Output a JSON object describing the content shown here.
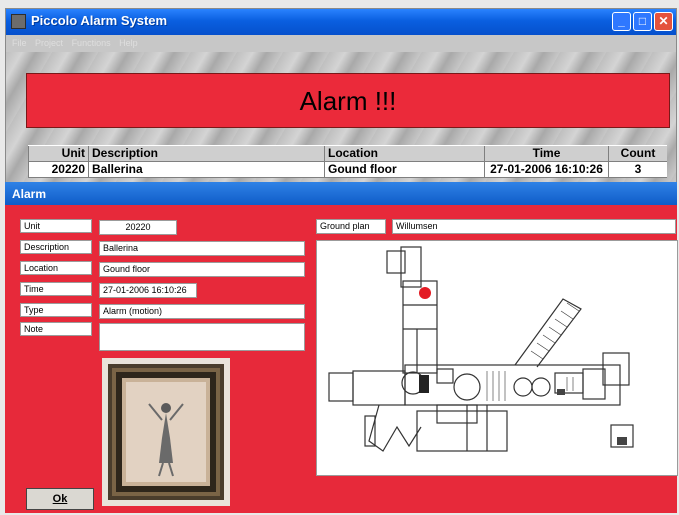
{
  "window": {
    "title": "Piccolo Alarm System"
  },
  "menu": [
    "File",
    "Project",
    "Functions",
    "Help"
  ],
  "banner": {
    "text": "Alarm !!!"
  },
  "table": {
    "headers": [
      "Unit",
      "Description",
      "Location",
      "Time",
      "Count"
    ],
    "rows": [
      [
        "20220",
        "Ballerina",
        "Gound floor",
        "27-01-2006 16:10:26",
        "3"
      ]
    ]
  },
  "dialog": {
    "title": "Alarm",
    "labels": {
      "unit": "Unit",
      "description": "Description",
      "location": "Location",
      "time": "Time",
      "type": "Type",
      "note": "Note",
      "ground_plan": "Ground plan"
    },
    "values": {
      "unit": "20220",
      "description": "Ballerina",
      "location": "Gound floor",
      "time": "27-01-2006 16:10:26",
      "type": "Alarm (motion)",
      "note": "",
      "ground_plan": "Willumsen"
    },
    "ok_label": "Ok"
  },
  "colors": {
    "alarm_red": "#eb2a3a",
    "dialog_red": "#e7293a",
    "titlebar_blue": "#0a5fe0",
    "marker_red": "#e31b23"
  }
}
